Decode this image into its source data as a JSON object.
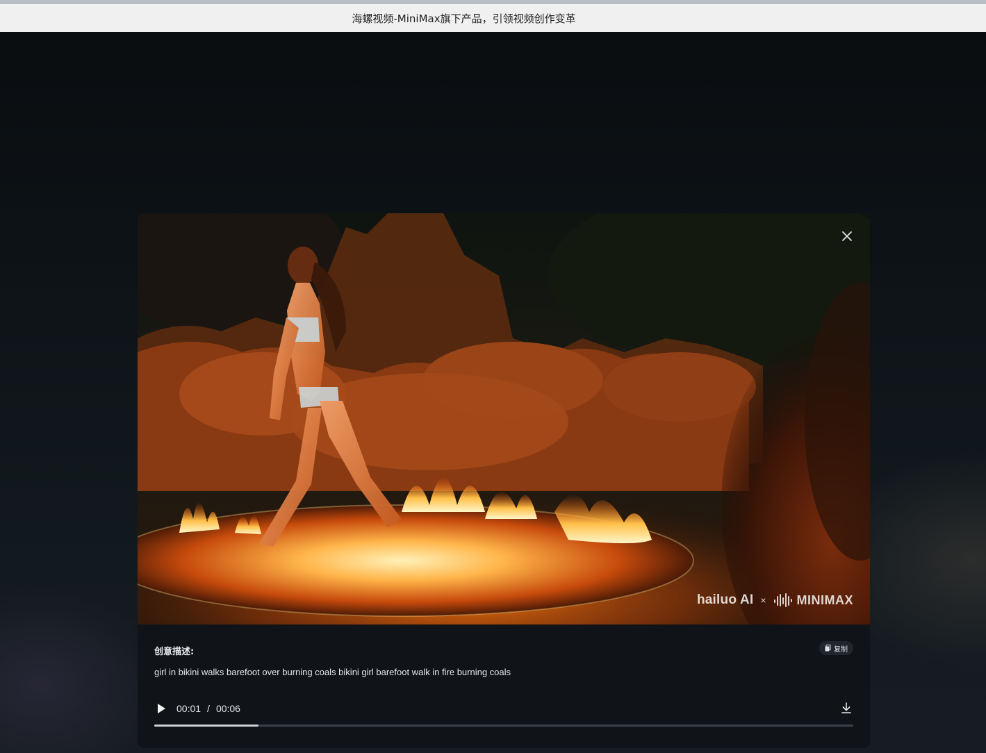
{
  "window": {
    "title": "海螺视频-MiniMax旗下产品，引领视频创作变革"
  },
  "video": {
    "watermark": {
      "brand": "hailuo AI",
      "separator": "×",
      "partner": "MINIMAX"
    },
    "close_icon": "close-icon"
  },
  "description": {
    "label": "创意描述:",
    "copy_label": "复制",
    "text": "girl in bikini walks barefoot over burning coals bikini girl barefoot walk in fire burning coals"
  },
  "player": {
    "current_time": "00:01",
    "time_separator": "/",
    "duration": "00:06",
    "progress_fraction": 0.149,
    "play_icon": "play-icon",
    "download_icon": "download-icon"
  },
  "colors": {
    "modal_bg": "#101418",
    "fire": "#ff8a1a",
    "progress_fill": "#cfd3d7",
    "progress_track": "#3a4047"
  }
}
